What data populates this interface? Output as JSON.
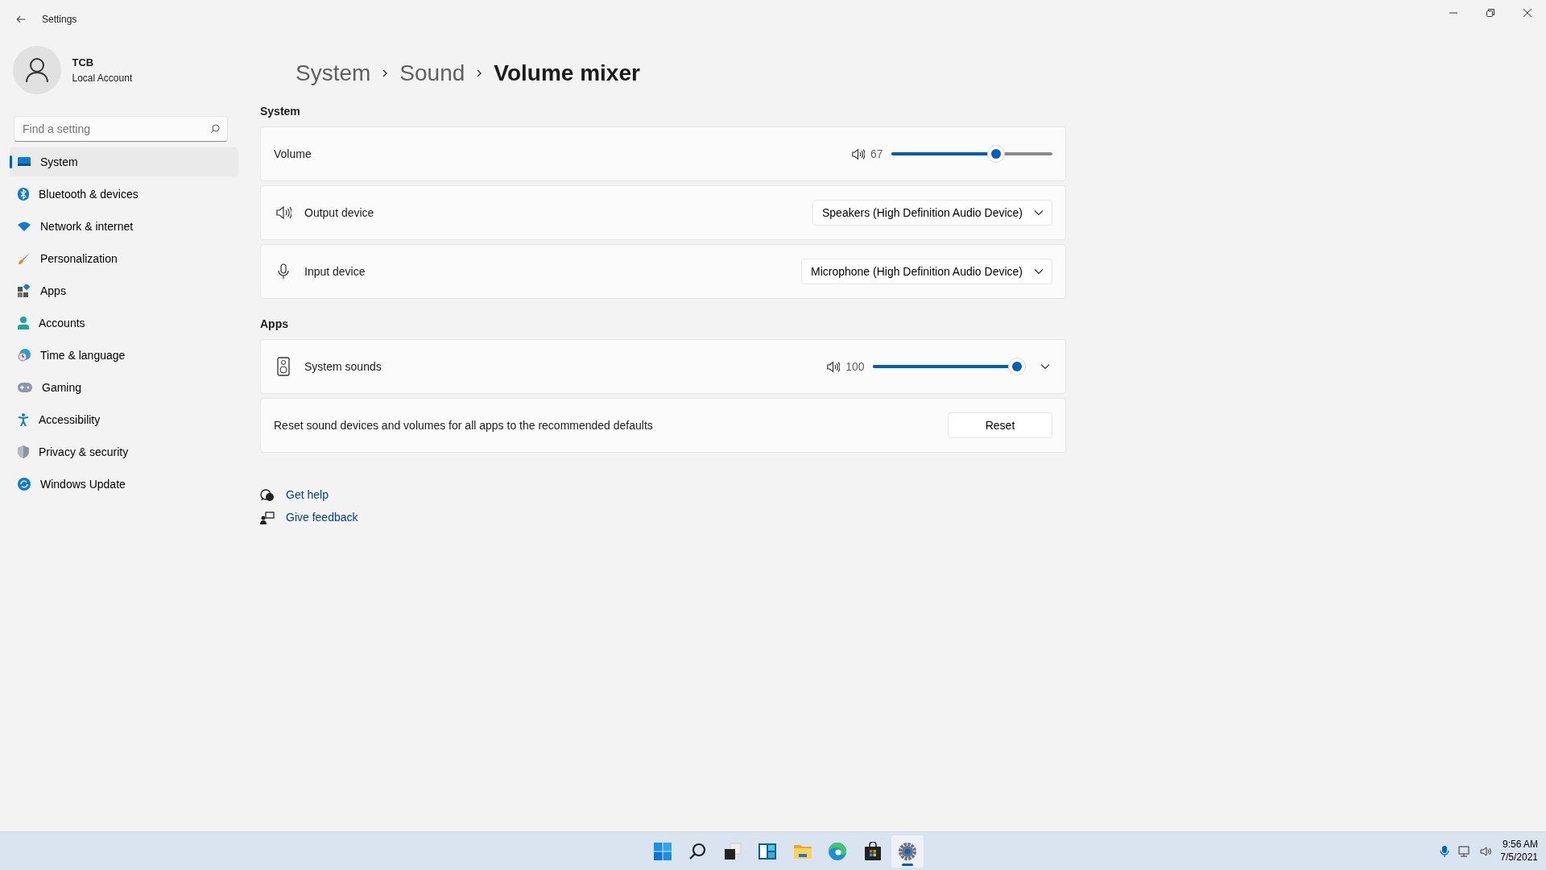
{
  "window": {
    "title": "Settings"
  },
  "user": {
    "name": "TCB",
    "account": "Local Account"
  },
  "search": {
    "placeholder": "Find a setting"
  },
  "nav": [
    {
      "label": "System",
      "selected": true
    },
    {
      "label": "Bluetooth & devices",
      "selected": false
    },
    {
      "label": "Network & internet",
      "selected": false
    },
    {
      "label": "Personalization",
      "selected": false
    },
    {
      "label": "Apps",
      "selected": false
    },
    {
      "label": "Accounts",
      "selected": false
    },
    {
      "label": "Time & language",
      "selected": false
    },
    {
      "label": "Gaming",
      "selected": false
    },
    {
      "label": "Accessibility",
      "selected": false
    },
    {
      "label": "Privacy & security",
      "selected": false
    },
    {
      "label": "Windows Update",
      "selected": false
    }
  ],
  "breadcrumb": [
    "System",
    "Sound",
    "Volume mixer"
  ],
  "sections": [
    {
      "heading": "System",
      "rows": [
        {
          "kind": "slider",
          "label": "Volume",
          "reading": "67",
          "level": 0.67
        },
        {
          "kind": "dropdown",
          "label": "Output device",
          "value": "Speakers (High Definition Audio Device)"
        },
        {
          "kind": "dropdown",
          "label": "Input device",
          "value": "Microphone (High Definition Audio Device)"
        }
      ]
    },
    {
      "heading": "Apps",
      "rows": [
        {
          "kind": "app",
          "label": "System sounds",
          "reading": "100",
          "level": 1.0,
          "expanded": false
        },
        {
          "kind": "action",
          "label": "Reset sound devices and volumes for all apps to the recommended defaults",
          "button": "Reset"
        }
      ]
    }
  ],
  "links": [
    {
      "kind": "help",
      "label": "Get help"
    },
    {
      "kind": "feedback",
      "label": "Give feedback"
    }
  ],
  "taskbar": [
    {
      "kind": "start",
      "selected": false
    },
    {
      "kind": "search",
      "selected": false
    },
    {
      "kind": "taskview",
      "selected": false
    },
    {
      "kind": "widgets",
      "selected": false
    },
    {
      "kind": "explorer",
      "selected": false
    },
    {
      "kind": "edge",
      "selected": false
    },
    {
      "kind": "store",
      "selected": false
    },
    {
      "kind": "settings",
      "selected": true
    }
  ],
  "tray": {
    "time": "9:56 AM",
    "date": "7/5/2021"
  }
}
